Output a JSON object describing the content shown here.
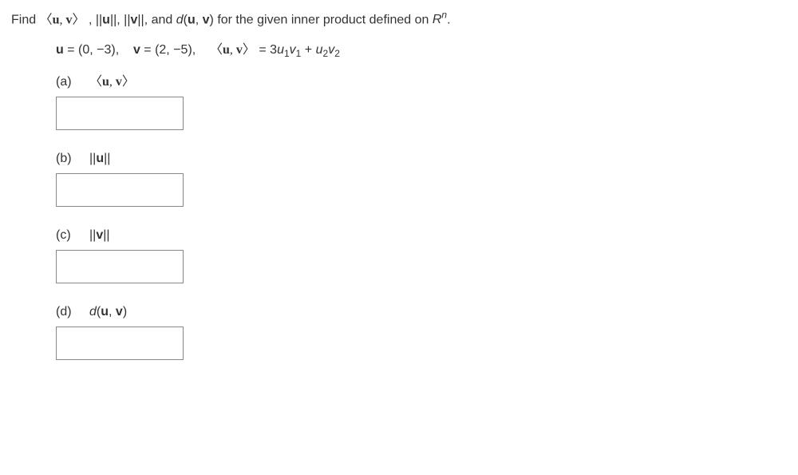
{
  "statement": {
    "prefix": "Find ",
    "uv_inner": "〈u, v〉",
    "sep1": ", ",
    "norm_u": "||u||",
    "sep2": ", ",
    "norm_v": "||v||",
    "sep3": ", and ",
    "d_uv_ital": "d",
    "d_uv_paren": "(u, v)",
    "middle": " for the given inner product defined on ",
    "rn_R": "R",
    "rn_n": "n",
    "period": "."
  },
  "setup": {
    "u_lbl": "u",
    "u_eq": " = (0, −3),",
    "gap": "   ",
    "v_lbl": "v",
    "v_eq": " = (2, −5),",
    "gap2": "   ",
    "uv_inner": "〈u, v〉",
    "inner_eq": " = 3",
    "u1_u": "u",
    "u1_s": "1",
    "v1_v": "v",
    "v1_s": "1",
    "plus": " + ",
    "u2_u": "u",
    "u2_s": "2",
    "v2_v": "v",
    "v2_s": "2"
  },
  "parts": {
    "a": {
      "label": "(a)",
      "expr": "〈u, v〉"
    },
    "b": {
      "label": "(b)",
      "expr_pre": "||",
      "expr_u": "u",
      "expr_post": "||"
    },
    "c": {
      "label": "(c)",
      "expr_pre": "||",
      "expr_v": "v",
      "expr_post": "||"
    },
    "d": {
      "label": "(d)",
      "expr_d": "d",
      "expr_paren": "(u, v)"
    }
  }
}
